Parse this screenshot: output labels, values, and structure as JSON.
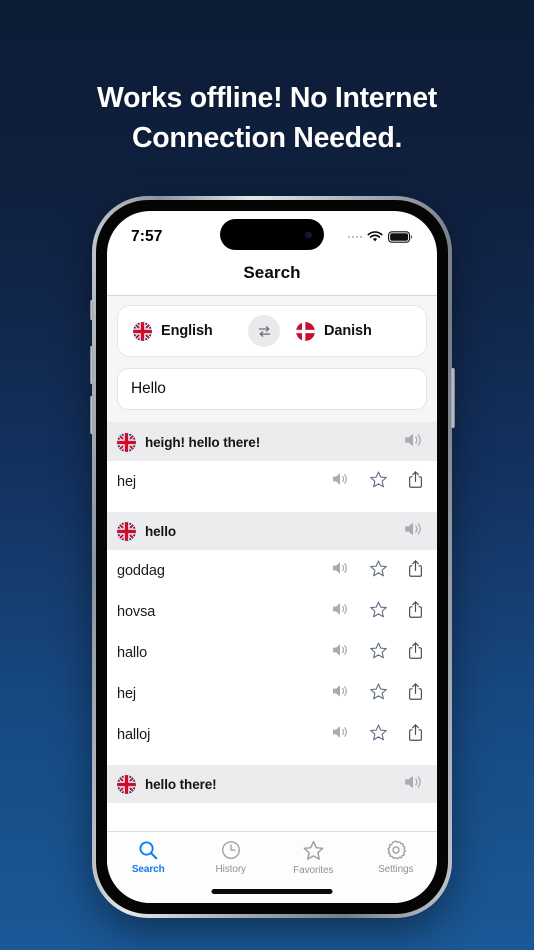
{
  "promo": {
    "headline_line1": "Works offline! No Internet",
    "headline_line2": "Connection Needed."
  },
  "status_bar": {
    "time": "7:57"
  },
  "nav": {
    "title": "Search"
  },
  "language_bar": {
    "source_language": "English",
    "source_flag": "uk-flag-icon",
    "target_language": "Danish",
    "target_flag": "denmark-flag-icon",
    "swap_icon": "swap-arrows-icon"
  },
  "search": {
    "value": "Hello",
    "placeholder": "Hello"
  },
  "results": {
    "groups": [
      {
        "header": "heigh! hello there!",
        "entries": [
          {
            "text": "hej"
          }
        ]
      },
      {
        "header": "hello",
        "entries": [
          {
            "text": "goddag"
          },
          {
            "text": "hovsa"
          },
          {
            "text": "hallo"
          },
          {
            "text": "hej"
          },
          {
            "text": "halloj"
          }
        ]
      },
      {
        "header": "hello there!",
        "entries": []
      }
    ]
  },
  "tabbar": {
    "tabs": [
      {
        "label": "Search",
        "icon": "magnifier-icon",
        "active": true
      },
      {
        "label": "History",
        "icon": "clock-icon",
        "active": false
      },
      {
        "label": "Favorites",
        "icon": "star-icon",
        "active": false
      },
      {
        "label": "Settings",
        "icon": "gear-icon",
        "active": false
      }
    ]
  },
  "colors": {
    "accent": "#0a7bf0",
    "background_top": "#0d1c35",
    "background_bottom": "#1b5897",
    "group_header_bg": "#ececee",
    "danish_red": "#c8102e"
  }
}
